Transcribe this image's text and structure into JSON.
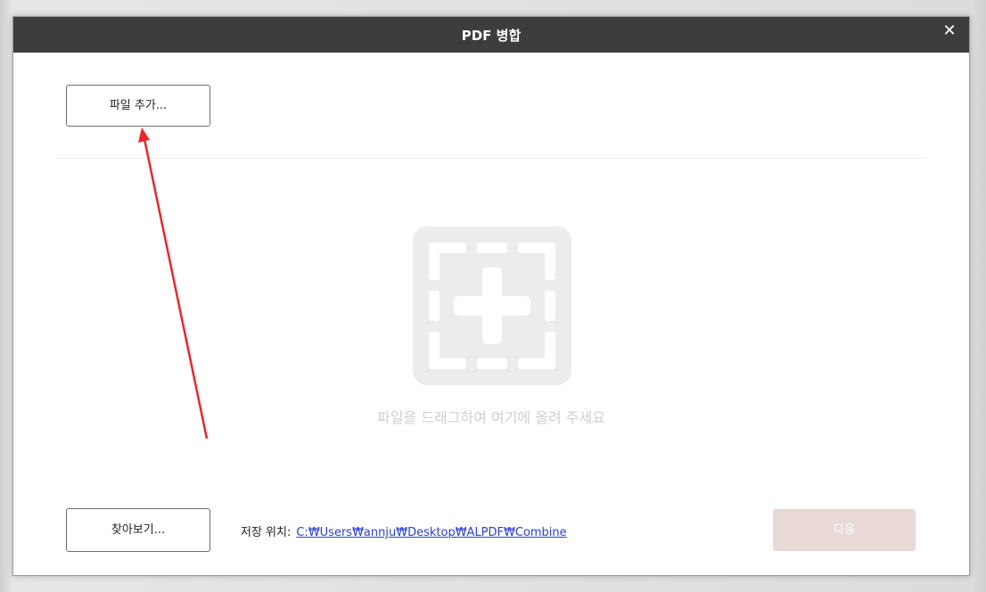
{
  "dialog": {
    "title": "PDF 병합",
    "close_label": "✕"
  },
  "toolbar": {
    "add_file_label": "파일 추가..."
  },
  "drop_zone": {
    "icon": "add-file-frame-icon",
    "hint": "파일을 드래그하여 여기에 올려 주세요"
  },
  "footer": {
    "browse_label": "찾아보기...",
    "save_location_label": "저장 위치:",
    "save_location_path": "C:₩Users₩annju₩Desktop₩ALPDF₩Combine",
    "next_label": "다음"
  },
  "colors": {
    "titlebar": "#3d3d3f",
    "link": "#2a3fd0",
    "next_disabled": "#e8d8d6",
    "annotation_arrow": "#e8282c"
  }
}
